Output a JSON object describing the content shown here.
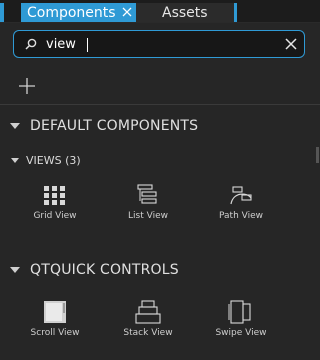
{
  "tabs": [
    {
      "label": "Components",
      "active": true
    },
    {
      "label": "Assets",
      "active": false
    }
  ],
  "search": {
    "value": "view",
    "placeholder": ""
  },
  "sections": [
    {
      "title": "DEFAULT COMPONENTS",
      "subsections": [
        {
          "title": "VIEWS (3)",
          "items": [
            {
              "label": "Grid View",
              "icon": "grid-view-icon"
            },
            {
              "label": "List View",
              "icon": "list-view-icon"
            },
            {
              "label": "Path View",
              "icon": "path-view-icon"
            }
          ]
        }
      ]
    },
    {
      "title": "QTQUICK CONTROLS",
      "items": [
        {
          "label": "Scroll View",
          "icon": "scroll-view-icon"
        },
        {
          "label": "Stack View",
          "icon": "stack-view-icon"
        },
        {
          "label": "Swipe View",
          "icon": "swipe-view-icon"
        }
      ]
    }
  ],
  "colors": {
    "accent": "#2f9ad5",
    "background": "#262626"
  }
}
